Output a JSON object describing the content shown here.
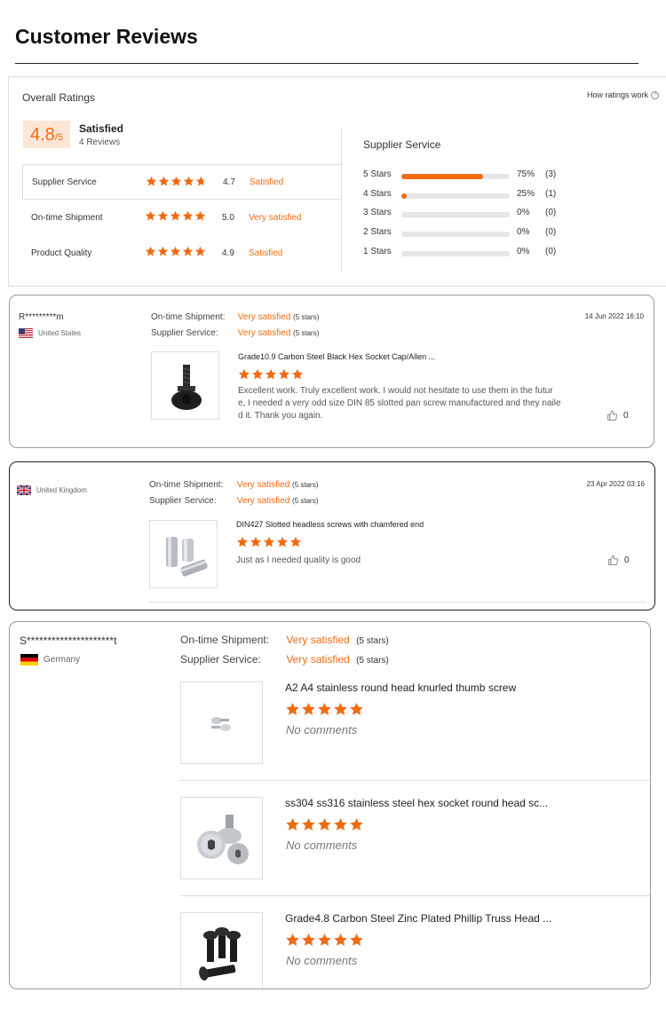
{
  "page_title": "Customer Reviews",
  "overall": {
    "label": "Overall Ratings",
    "how_link": "How ratings work",
    "score": "4.8",
    "score_suffix": "/5",
    "status": "Satisfied",
    "review_count": "4 Reviews",
    "metrics": [
      {
        "label": "Supplier Service",
        "value": "4.7",
        "text": "Satisfied",
        "rating": 4.7
      },
      {
        "label": "On-time Shipment",
        "value": "5.0",
        "text": "Very satisfied",
        "rating": 5.0
      },
      {
        "label": "Product Quality",
        "value": "4.9",
        "text": "Satisfied",
        "rating": 4.9
      }
    ],
    "supplier_service": {
      "title": "Supplier Service",
      "rows": [
        {
          "label": "5 Stars",
          "pct": "75%",
          "count": "(3)",
          "fraction": 0.75
        },
        {
          "label": "4 Stars",
          "pct": "25%",
          "count": "(1)",
          "fraction": 0.05
        },
        {
          "label": "3 Stars",
          "pct": "0%",
          "count": "(0)",
          "fraction": 0
        },
        {
          "label": "2 Stars",
          "pct": "0%",
          "count": "(0)",
          "fraction": 0
        },
        {
          "label": "1 Stars",
          "pct": "0%",
          "count": "(0)",
          "fraction": 0
        }
      ]
    }
  },
  "reviews": [
    {
      "reviewer": "R*********m",
      "country": "United States",
      "shipment_label": "On-time Shipment:",
      "shipment_value": "Very satisfied",
      "shipment_count": "(5 stars)",
      "service_label": "Supplier Service:",
      "service_value": "Very satisfied",
      "service_count": "(5 stars)",
      "date": "14 Jun 2022 16:10",
      "product_title": "Grade10.9 Carbon Steel Black Hex Socket Cap/Allen ...",
      "comment_lines": [
        "Excellent work.  Truly excellent work.  I would not hesitate to use them in the futur",
        "e, I needed a very odd size DIN 85 slotted pan screw manufactured and they naile",
        "d it.  Thank you again."
      ],
      "likes": "0"
    },
    {
      "reviewer": "",
      "country": "United Kingdom",
      "shipment_label": "On-time Shipment:",
      "shipment_value": "Very satisfied",
      "shipment_count": "(5 stars)",
      "service_label": "Supplier Service:",
      "service_value": "Very satisfied",
      "service_count": "(5 stars)",
      "date": "23 Apr 2022 03:16",
      "product_title": "DIN427 Slotted headless screws with chamfered end",
      "comment_lines": [
        "Just as I needed quality is good"
      ],
      "likes": "0"
    },
    {
      "reviewer": "S*********************t",
      "country": "Germany",
      "shipment_label": "On-time Shipment:",
      "shipment_value": "Very satisfied",
      "shipment_count": "(5 stars)",
      "service_label": "Supplier Service:",
      "service_value": "Very satisfied",
      "service_count": "(5 stars)",
      "products": [
        {
          "title": "A2 A4 stainless round head knurled thumb screw",
          "comment": "No comments"
        },
        {
          "title": "ss304 ss316 stainless steel hex socket round head sc...",
          "comment": "No comments"
        },
        {
          "title": "Grade4.8 Carbon Steel Zinc Plated Phillip Truss Head ...",
          "comment": "No comments"
        }
      ]
    }
  ],
  "colors": {
    "accent": "#f06a12",
    "accent_bg": "#fde6d6",
    "border": "#dddddd"
  },
  "icons": [
    "help-icon",
    "star-icon",
    "half-star-icon",
    "thumbs-up-icon",
    "flag-us-icon",
    "flag-uk-icon",
    "flag-de-icon"
  ]
}
